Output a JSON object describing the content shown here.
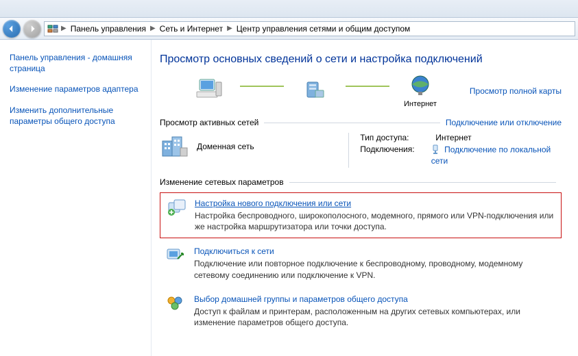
{
  "breadcrumb": {
    "items": [
      "Панель управления",
      "Сеть и Интернет",
      "Центр управления сетями и общим доступом"
    ]
  },
  "sidebar": {
    "links": [
      "Панель управления - домашняя страница",
      "Изменение параметров адаптера",
      "Изменить дополнительные параметры общего доступа"
    ]
  },
  "heading": "Просмотр основных сведений о сети и настройка подключений",
  "map": {
    "node3_label": "Интернет",
    "full_map_link": "Просмотр полной карты"
  },
  "active_nets": {
    "header": "Просмотр активных сетей",
    "right_link": "Подключение или отключение",
    "net_type": "Доменная сеть",
    "props": {
      "k1": "Тип доступа:",
      "v1": "Интернет",
      "k2": "Подключения:",
      "v2": "Подключение по локальной сети"
    }
  },
  "params": {
    "header": "Изменение сетевых параметров",
    "tasks": [
      {
        "title": "Настройка нового подключения или сети",
        "desc": "Настройка беспроводного, широкополосного, модемного, прямого или VPN-подключения или же настройка маршрутизатора или точки доступа."
      },
      {
        "title": "Подключиться к сети",
        "desc": "Подключение или повторное подключение к беспроводному, проводному, модемному сетевому соединению или подключение к VPN."
      },
      {
        "title": "Выбор домашней группы и параметров общего доступа",
        "desc": "Доступ к файлам и принтерам, расположенным на других сетевых компьютерах, или изменение параметров общего доступа."
      }
    ]
  }
}
